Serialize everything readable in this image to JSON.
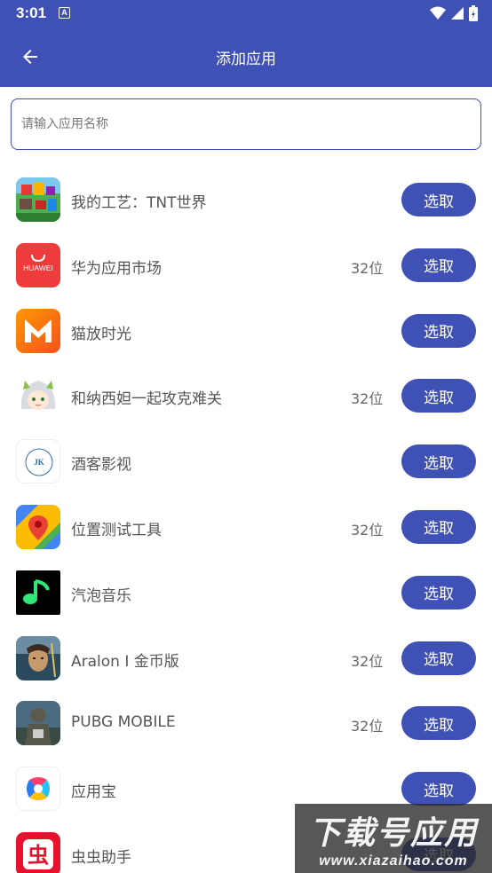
{
  "status": {
    "time": "3:01",
    "notification_letter": "A"
  },
  "header": {
    "title": "添加应用"
  },
  "search": {
    "placeholder": "请输入应用名称"
  },
  "apps": [
    {
      "name": "我的工艺：TNT世界",
      "bits": "",
      "button": "选取",
      "icon": "tnt-world-icon"
    },
    {
      "name": "华为应用市场",
      "bits": "32位",
      "button": "选取",
      "icon": "huawei-appgallery-icon",
      "icon_text": "HUAWEI"
    },
    {
      "name": "猫放时光",
      "bits": "",
      "button": "选取",
      "icon": "maofang-icon"
    },
    {
      "name": "和纳西妲一起攻克难关",
      "bits": "32位",
      "button": "选取",
      "icon": "anime-girl-icon"
    },
    {
      "name": "酒客影视",
      "bits": "",
      "button": "选取",
      "icon": "jiuke-icon",
      "icon_text": "JK"
    },
    {
      "name": "位置测试工具",
      "bits": "32位",
      "button": "选取",
      "icon": "map-pin-icon"
    },
    {
      "name": "汽泡音乐",
      "bits": "",
      "button": "选取",
      "icon": "music-note-icon"
    },
    {
      "name": "Aralon I 金币版",
      "bits": "32位",
      "button": "选取",
      "icon": "aralon-icon"
    },
    {
      "name": "PUBG MOBILE",
      "bits": "32位",
      "button": "选取",
      "icon": "pubg-icon"
    },
    {
      "name": "应用宝",
      "bits": "",
      "button": "选取",
      "icon": "yingyongbao-icon"
    },
    {
      "name": "虫虫助手",
      "bits": "",
      "button": "选取",
      "icon": "chongchong-icon",
      "icon_text": "虫"
    }
  ],
  "watermark": {
    "main": "下载号应用",
    "sub": "www.xiazaihao.com"
  },
  "colors": {
    "primary": "#3f51b5",
    "text": "#555555"
  }
}
